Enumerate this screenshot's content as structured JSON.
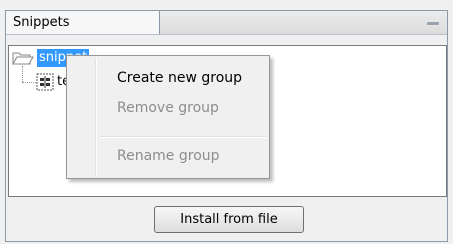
{
  "panel": {
    "title": "Snippets"
  },
  "tree": {
    "root_label": "snippet",
    "child_label": "tection"
  },
  "context_menu": {
    "items": [
      {
        "label": "Create new group",
        "enabled": true
      },
      {
        "label": "Remove group",
        "enabled": false
      },
      {
        "label": "Rename group",
        "enabled": false
      }
    ]
  },
  "footer": {
    "install_label": "Install from file"
  },
  "colors": {
    "selection": "#3399ff",
    "border": "#8e9aa6",
    "disabled_text": "#8d8d8d"
  }
}
